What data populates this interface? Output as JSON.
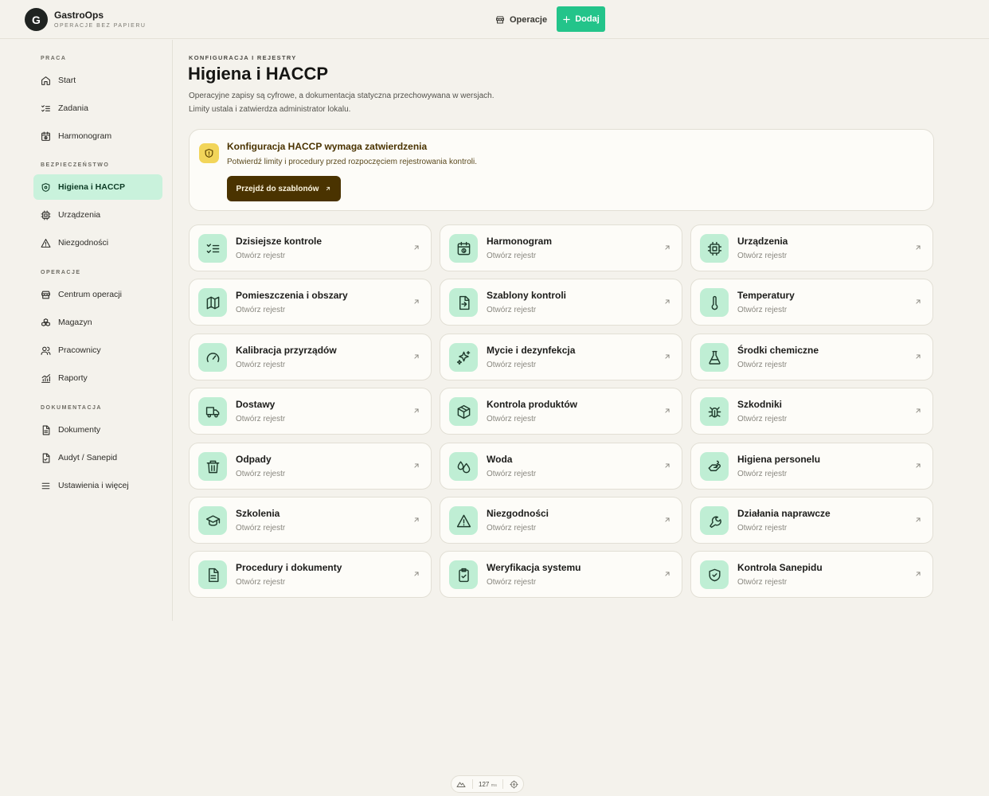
{
  "header": {
    "logo_letter": "G",
    "brand": "GastroOps",
    "tagline": "OPERACJE BEZ PAPIERU",
    "nav_ops": "Operacje",
    "add_label": "Dodaj"
  },
  "sidebar": {
    "sections": [
      {
        "title": "PRACA",
        "items": [
          {
            "label": "Start",
            "icon": "home-icon"
          },
          {
            "label": "Zadania",
            "icon": "list-check-icon"
          },
          {
            "label": "Harmonogram",
            "icon": "calendar-clock-icon"
          }
        ]
      },
      {
        "title": "BEZPIECZEŃSTWO",
        "items": [
          {
            "label": "Higiena i HACCP",
            "icon": "shield-icon",
            "active": true
          },
          {
            "label": "Urządzenia",
            "icon": "chip-icon"
          },
          {
            "label": "Niezgodności",
            "icon": "warning-icon"
          }
        ]
      },
      {
        "title": "OPERACJE",
        "items": [
          {
            "label": "Centrum operacji",
            "icon": "store-icon"
          },
          {
            "label": "Magazyn",
            "icon": "boxes-icon"
          },
          {
            "label": "Pracownicy",
            "icon": "users-icon"
          },
          {
            "label": "Raporty",
            "icon": "chart-icon"
          }
        ]
      },
      {
        "title": "DOKUMENTACJA",
        "items": [
          {
            "label": "Dokumenty",
            "icon": "document-icon"
          },
          {
            "label": "Audyt / Sanepid",
            "icon": "document-check-icon"
          },
          {
            "label": "Ustawienia i więcej",
            "icon": "menu-icon"
          }
        ]
      }
    ]
  },
  "main": {
    "eyebrow": "KONFIGURACJA I REJESTRY",
    "title": "Higiena i HACCP",
    "desc_line1": "Operacyjne zapisy są cyfrowe, a dokumentacja statyczna przechowywana w wersjach.",
    "desc_line2": "Limity ustala i zatwierdza administrator lokalu."
  },
  "alert": {
    "title": "Konfiguracja HACCP wymaga zatwierdzenia",
    "text": "Potwierdź limity i procedury przed rozpoczęciem rejestrowania kontroli.",
    "button": "Przejdź do szablonów"
  },
  "cards": [
    {
      "title": "Dzisiejsze kontrole",
      "sub": "Otwórz rejestr",
      "icon": "list-check-icon"
    },
    {
      "title": "Harmonogram",
      "sub": "Otwórz rejestr",
      "icon": "calendar-clock-icon"
    },
    {
      "title": "Urządzenia",
      "sub": "Otwórz rejestr",
      "icon": "chip-icon"
    },
    {
      "title": "Pomieszczenia i obszary",
      "sub": "Otwórz rejestr",
      "icon": "map-icon"
    },
    {
      "title": "Szablony kontroli",
      "sub": "Otwórz rejestr",
      "icon": "file-import-icon"
    },
    {
      "title": "Temperatury",
      "sub": "Otwórz rejestr",
      "icon": "thermometer-icon"
    },
    {
      "title": "Kalibracja przyrządów",
      "sub": "Otwórz rejestr",
      "icon": "gauge-icon"
    },
    {
      "title": "Mycie i dezynfekcja",
      "sub": "Otwórz rejestr",
      "icon": "sparkles-icon"
    },
    {
      "title": "Środki chemiczne",
      "sub": "Otwórz rejestr",
      "icon": "flask-icon"
    },
    {
      "title": "Dostawy",
      "sub": "Otwórz rejestr",
      "icon": "truck-icon"
    },
    {
      "title": "Kontrola produktów",
      "sub": "Otwórz rejestr",
      "icon": "package-icon"
    },
    {
      "title": "Szkodniki",
      "sub": "Otwórz rejestr",
      "icon": "bug-icon"
    },
    {
      "title": "Odpady",
      "sub": "Otwórz rejestr",
      "icon": "trash-icon"
    },
    {
      "title": "Woda",
      "sub": "Otwórz rejestr",
      "icon": "droplets-icon"
    },
    {
      "title": "Higiena personelu",
      "sub": "Otwórz rejestr",
      "icon": "hand-wash-icon"
    },
    {
      "title": "Szkolenia",
      "sub": "Otwórz rejestr",
      "icon": "graduation-cap-icon"
    },
    {
      "title": "Niezgodności",
      "sub": "Otwórz rejestr",
      "icon": "warning-icon"
    },
    {
      "title": "Działania naprawcze",
      "sub": "Otwórz rejestr",
      "icon": "wrench-icon"
    },
    {
      "title": "Procedury i dokumenty",
      "sub": "Otwórz rejestr",
      "icon": "document-icon"
    },
    {
      "title": "Weryfikacja systemu",
      "sub": "Otwórz rejestr",
      "icon": "clipboard-check-icon"
    },
    {
      "title": "Kontrola Sanepidu",
      "sub": "Otwórz rejestr",
      "icon": "shield-check-icon"
    }
  ],
  "footer": {
    "ms_value": "127",
    "ms_unit": "ms"
  },
  "colors": {
    "accent": "#23c48a",
    "active_bg": "#c9f2dc",
    "icon_tile": "#bfeed4",
    "alert_icon": "#f2d55a",
    "alert_button": "#4a3300"
  }
}
